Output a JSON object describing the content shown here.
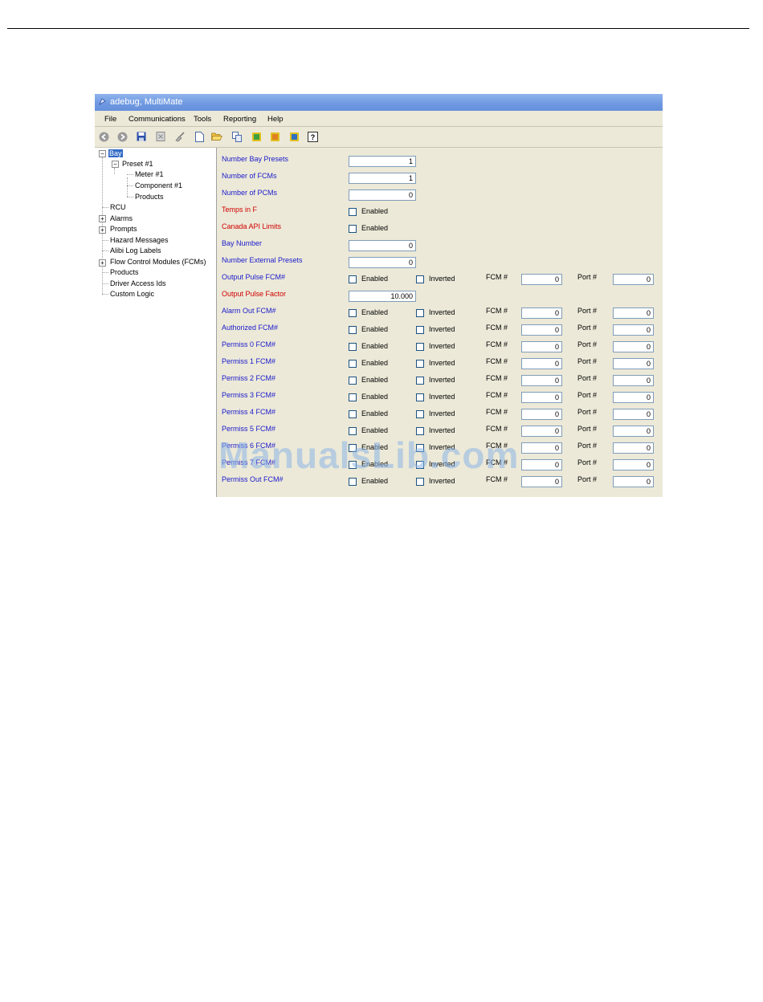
{
  "window": {
    "title": "adebug, MultiMate"
  },
  "menu": [
    "File",
    "Communications",
    "Tools",
    "Reporting",
    "Help"
  ],
  "toolbar_icons": [
    "back-icon",
    "forward-icon",
    "save-icon",
    "close-doc-icon",
    "brush-icon",
    "new-doc-icon",
    "open-folder-icon",
    "copy-icon",
    "module-green-icon",
    "module-orange-icon",
    "module-blue-icon",
    "help-icon"
  ],
  "tree": {
    "bay": "Bay",
    "preset": "Preset #1",
    "meter": "Meter #1",
    "component": "Component #1",
    "preset_products": "Products",
    "rcu": "RCU",
    "alarms": "Alarms",
    "prompts": "Prompts",
    "hazard": "Hazard Messages",
    "alibi": "Alibi Log Labels",
    "fcms": "Flow Control Modules (FCMs)",
    "products": "Products",
    "driver": "Driver Access Ids",
    "custom": "Custom Logic"
  },
  "fields": {
    "number_bay_presets": {
      "label": "Number Bay Presets",
      "value": "1"
    },
    "number_fcms": {
      "label": "Number of FCMs",
      "value": "1"
    },
    "number_pcms": {
      "label": "Number of PCMs",
      "value": "0"
    },
    "temps_in_f": {
      "label": "Temps in F"
    },
    "canada_api": {
      "label": "Canada API Limits"
    },
    "bay_number": {
      "label": "Bay Number",
      "value": "0"
    },
    "external_presets": {
      "label": "Number External Presets",
      "value": "0"
    },
    "output_pulse_factor": {
      "label": "Output Pulse Factor",
      "value": "10.000"
    }
  },
  "text": {
    "enabled": "Enabled",
    "inverted": "Inverted",
    "fcm": "FCM #",
    "port": "Port #"
  },
  "io_rows": [
    {
      "label": "Output Pulse FCM#",
      "fcm": "0",
      "port": "0"
    },
    {
      "label": "Alarm Out FCM#",
      "fcm": "0",
      "port": "0"
    },
    {
      "label": "Authorized FCM#",
      "fcm": "0",
      "port": "0"
    },
    {
      "label": "Permiss 0 FCM#",
      "fcm": "0",
      "port": "0"
    },
    {
      "label": "Permiss 1 FCM#",
      "fcm": "0",
      "port": "0"
    },
    {
      "label": "Permiss 2 FCM#",
      "fcm": "0",
      "port": "0"
    },
    {
      "label": "Permiss 3 FCM#",
      "fcm": "0",
      "port": "0"
    },
    {
      "label": "Permiss 4 FCM#",
      "fcm": "0",
      "port": "0"
    },
    {
      "label": "Permiss 5 FCM#",
      "fcm": "0",
      "port": "0"
    },
    {
      "label": "Permiss 6 FCM#",
      "fcm": "0",
      "port": "0"
    },
    {
      "label": "Permiss 7 FCM#",
      "fcm": "0",
      "port": "0"
    },
    {
      "label": "Permiss Out FCM#",
      "fcm": "0",
      "port": "0"
    }
  ],
  "watermark": "ManualsLib.com"
}
